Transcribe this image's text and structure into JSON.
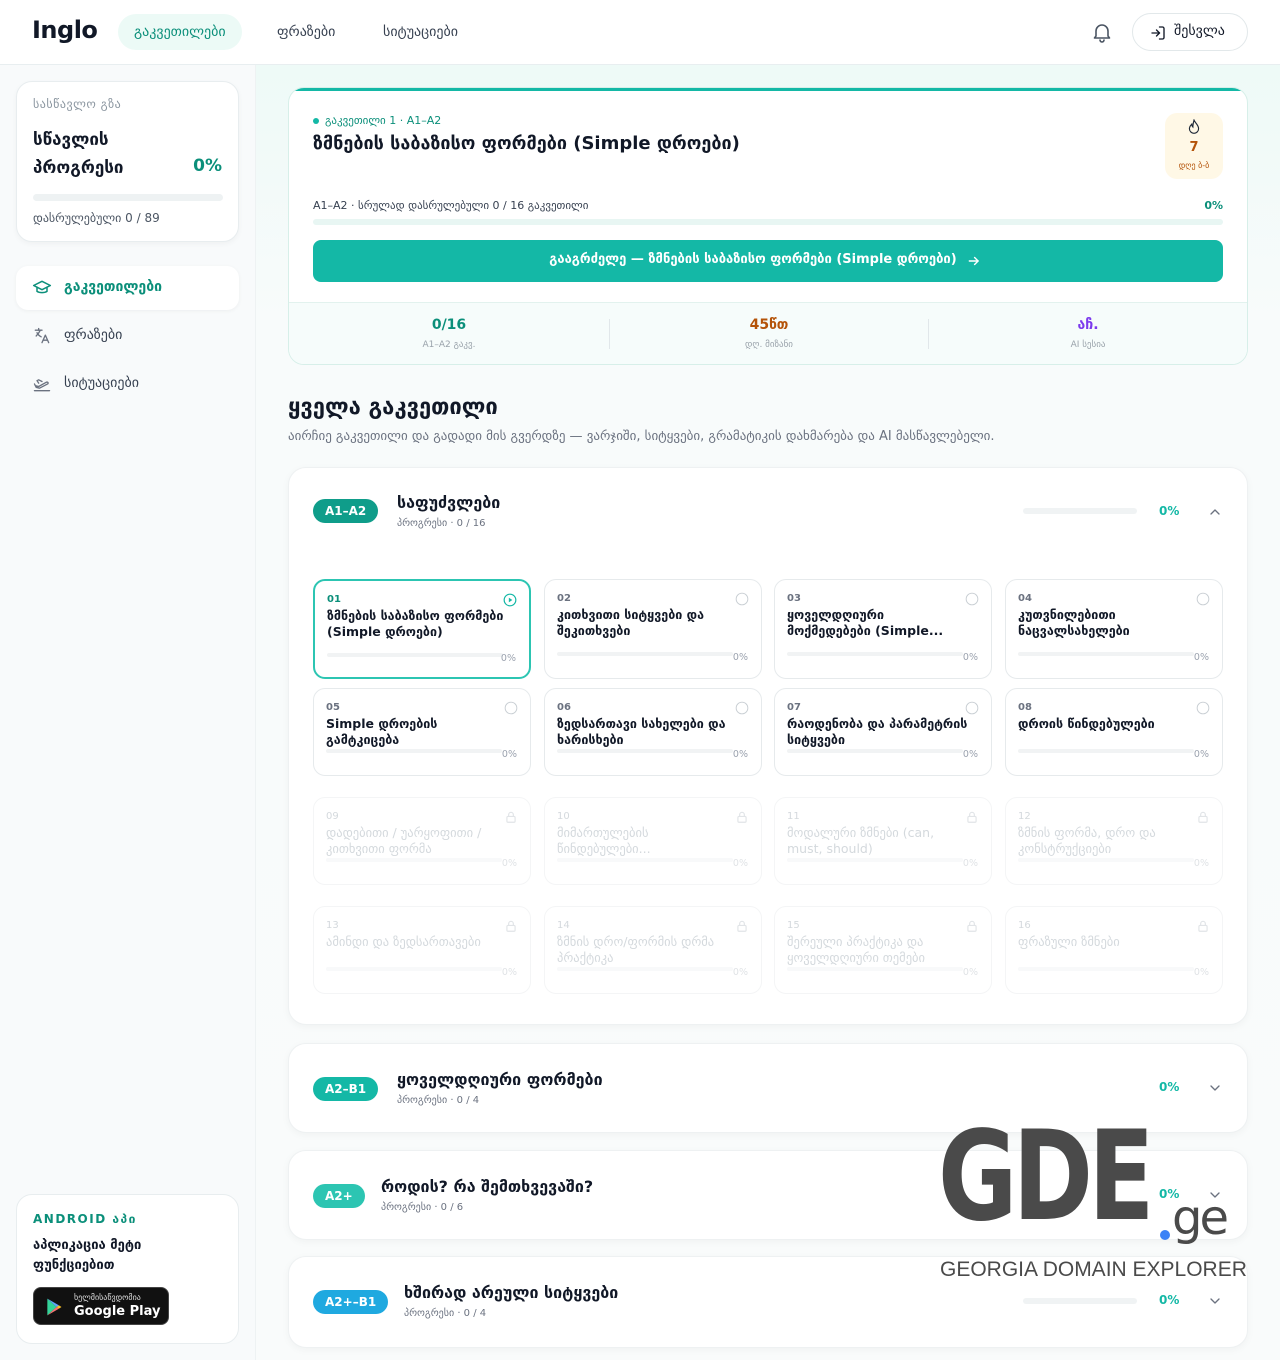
{
  "header": {
    "logo": "Inglo",
    "nav": [
      "გაკვეთილები",
      "ფრაზები",
      "სიტუაციები"
    ],
    "login": "შესვლა"
  },
  "sidebar": {
    "progress": {
      "kicker": "სასწავლო გზა",
      "title": "სწავლის პროგრესი",
      "percent": "0%",
      "percent_value": 0,
      "done": "დასრულებული 0 / 89"
    },
    "nav": [
      "გაკვეთილები",
      "ფრაზები",
      "სიტუაციები"
    ],
    "android": {
      "kicker": "ANDROID აპი",
      "text": "აპლიკაცია მეტი ფუნქციებით",
      "store_small": "ხელმისაწვდომია",
      "store_big": "Google Play"
    }
  },
  "hero": {
    "kicker": "გაკვეთილი 1 · A1–A2",
    "title": "ზმნების საბაზისო ფორმები (Simple დროები)",
    "streak": {
      "icon": "fire-icon",
      "value": "7",
      "label": "დღე ბ-ბ"
    },
    "level_line": "A1–A2 · სრულად დასრულებული 0 / 16 გაკვეთილი",
    "level_pct": "0%",
    "level_pct_value": 0,
    "continue": "გააგრძელე — ზმნების საბაზისო ფორმები (Simple დროები)",
    "stats": [
      {
        "value": "0/16",
        "label": "A1–A2 გაკვ.",
        "color": "#0b8f7a"
      },
      {
        "value": "45წთ",
        "label": "დღ. მიზანი",
        "color": "#b45309"
      },
      {
        "value": "აჩ.",
        "label": "AI სესია",
        "color": "#7c3aed"
      }
    ]
  },
  "section": {
    "title": "ყველა გაკვეთილი",
    "subtitle": "აირჩიე გაკვეთილი და გადადი მის გვერდზე — ვარჯიში, სიტყვები, გრამატიკის დახმარება და AI მასწავლებელი."
  },
  "groups": [
    {
      "badge": "A1–A2",
      "badge_color": "#0f9d8a",
      "title": "საფუძვლები",
      "progress": "პროგრესი · 0 / 16",
      "pct": "0%",
      "pct_value": 0,
      "expanded": true,
      "lessons": [
        {
          "num": "01",
          "title": "ზმნების საბაზისო ფორმები (Simple დროები)",
          "pct": "0%",
          "pct_value": 0,
          "state": "active"
        },
        {
          "num": "02",
          "title": "კითხვითი სიტყვები და შეკითხვები",
          "pct": "0%",
          "pct_value": 0,
          "state": "open"
        },
        {
          "num": "03",
          "title": "ყოველდღიური მოქმედებები (Simple...",
          "pct": "0%",
          "pct_value": 0,
          "state": "open"
        },
        {
          "num": "04",
          "title": "კუთვნილებითი ნაცვალსახელები",
          "pct": "0%",
          "pct_value": 0,
          "state": "open"
        },
        {
          "num": "05",
          "title": "Simple დროების გამტკიცება",
          "pct": "0%",
          "pct_value": 0,
          "state": "open"
        },
        {
          "num": "06",
          "title": "ზედსართავი სახელები და ხარისხები",
          "pct": "0%",
          "pct_value": 0,
          "state": "open"
        },
        {
          "num": "07",
          "title": "რაოდენობა და პარამეტრის სიტყვები",
          "pct": "0%",
          "pct_value": 0,
          "state": "open"
        },
        {
          "num": "08",
          "title": "დროის წინდებულები",
          "pct": "0%",
          "pct_value": 0,
          "state": "open"
        },
        {
          "num": "09",
          "title": "დადებითი / უარყოფითი / კითხვითი ფორმა",
          "pct": "0%",
          "pct_value": 0,
          "state": "locked"
        },
        {
          "num": "10",
          "title": "მიმართულების წინდებულები...",
          "pct": "0%",
          "pct_value": 0,
          "state": "locked"
        },
        {
          "num": "11",
          "title": "მოდალური ზმნები (can, must, should)",
          "pct": "0%",
          "pct_value": 0,
          "state": "locked"
        },
        {
          "num": "12",
          "title": "ზმნის ფორმა, დრო და კონსტრუქციები",
          "pct": "0%",
          "pct_value": 0,
          "state": "locked"
        },
        {
          "num": "13",
          "title": "ამინდი და ზედსართავები",
          "pct": "0%",
          "pct_value": 0,
          "state": "locked"
        },
        {
          "num": "14",
          "title": "ზმნის დრო/ფორმის დრმა პრაქტიკა",
          "pct": "0%",
          "pct_value": 0,
          "state": "locked"
        },
        {
          "num": "15",
          "title": "შერეული პრაქტიკა და ყოველდღიური თემები",
          "pct": "0%",
          "pct_value": 0,
          "state": "locked"
        },
        {
          "num": "16",
          "title": "ფრაზული ზმნები",
          "pct": "0%",
          "pct_value": 0,
          "state": "locked"
        }
      ]
    },
    {
      "badge": "A2–B1",
      "badge_color": "#14b8a6",
      "title": "ყოველდღიური ფორმები",
      "progress": "პროგრესი · 0 / 4",
      "pct": "0%",
      "pct_value": 0,
      "expanded": false
    },
    {
      "badge": "A2+",
      "badge_color": "#2cc5b2",
      "title": "როდის? რა შემთხვევაში?",
      "progress": "პროგრესი · 0 / 6",
      "pct": "0%",
      "pct_value": 0,
      "expanded": false
    },
    {
      "badge": "A2+–B1",
      "badge_color": "#1fa9e0",
      "title": "ხშირად არეული სიტყვები",
      "progress": "პროგრესი · 0 / 4",
      "pct": "0%",
      "pct_value": 0,
      "expanded": false
    }
  ],
  "watermark": {
    "letters": "GDE",
    "suffix": "ge",
    "caption": "GEORGIA DOMAIN EXPLORER"
  }
}
